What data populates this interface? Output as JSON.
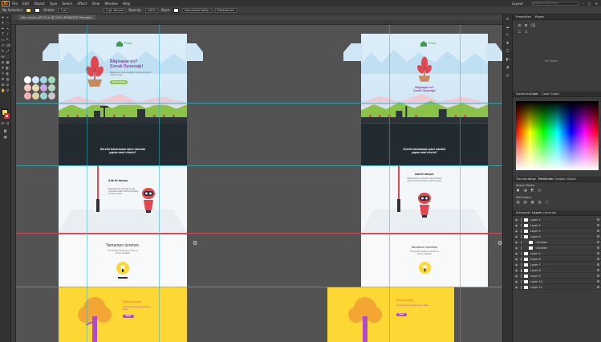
{
  "app": {
    "logo": "Ai"
  },
  "menubar": {
    "items": [
      "File",
      "Edit",
      "Object",
      "Type",
      "Select",
      "Effect",
      "View",
      "Window",
      "Help"
    ],
    "workspace": "Layout",
    "search_placeholder": "Search Adobe Stock"
  },
  "controlbar": {
    "selection": "No Selection",
    "stroke_label": "Stroke:",
    "stroke_value": "1 pt",
    "brush_value": "5 pt. Round",
    "opacity_label": "Opacity:",
    "opacity_value": "100%",
    "style_label": "Style:",
    "doc_setup": "Document Setup",
    "preferences": "Preferences"
  },
  "document": {
    "tab_title": "site_mock_AP 02.ai @ 25% (RGB/GPU Preview)"
  },
  "artboard": {
    "brand": "Prodi",
    "hero_title": "Bilgisayar mı?\nÇocuk Oyuncağı!",
    "hero_text": "Bilgisayarın nasıl çalıştığını merak ediyorsan hemen başla.",
    "hero_button": "Hemen Başla",
    "band_text": "Sürekli tekrarlanan işleri robotlar yapsa nasıl olurdu?",
    "step_title": "Ada ile tanışın.",
    "step_text": "Bilgisayarlarla oynamak bu ada yolculukla başlar. Robotunla birlikte çözümleri keşfet.",
    "free_title": "Tamamen ücretsiz.",
    "free_text": "Tüm içerikler herkes için ücretsiz ve sınırsız erişilebilir.",
    "y_title": "Şimdi başla!",
    "y_text": "Kendi robotunu yapmaya hemen başla.",
    "y_button": "Başla"
  },
  "swatches": {
    "colors": [
      "#ffffff",
      "#cfe8ff",
      "#a7d8e6",
      "#9be0b4",
      "#f8c7c0",
      "#e6dfb0",
      "#c9a7ea",
      "#b2d8c0",
      "#f4b1b1",
      "#dcd0a4",
      "#9fd4d6",
      "#c8c8c8"
    ]
  },
  "panels": {
    "top_tabs": [
      "Properties",
      "Pages"
    ],
    "swatch_hint": "No Pages",
    "color_tabs": [
      "Swatches",
      "Color",
      "Color Guide"
    ],
    "mid_tabs": [
      "Transform",
      "Align",
      "Pathfinder",
      "Graphic Styles"
    ],
    "shape_modes": "Shape Modes:",
    "pathfinders": "Pathfinders:",
    "layer_tabs": [
      "Artboards",
      "Layers",
      "Libraries"
    ],
    "layers": [
      {
        "name": "Layer 1",
        "color": "#4a8dff"
      },
      {
        "name": "Layer 2",
        "color": "#ff4a4a"
      },
      {
        "name": "Layer 3",
        "color": "#50c850"
      },
      {
        "name": "Layer 4",
        "color": "#4a8dff"
      },
      {
        "name": "<Guide>",
        "color": "#ff4a4a"
      },
      {
        "name": "<Guide>",
        "color": "#c84ac8"
      },
      {
        "name": "Layer 5",
        "color": "#4a8dff"
      },
      {
        "name": "Layer 6",
        "color": "#50c850"
      },
      {
        "name": "Layer 7",
        "color": "#ff4a4a"
      },
      {
        "name": "Layer 8",
        "color": "#ffd24a"
      },
      {
        "name": "Layer 9",
        "color": "#4a8dff"
      },
      {
        "name": "Layer 10",
        "color": "#c84ac8"
      },
      {
        "name": "Layer 11",
        "color": "#50c850"
      }
    ]
  }
}
